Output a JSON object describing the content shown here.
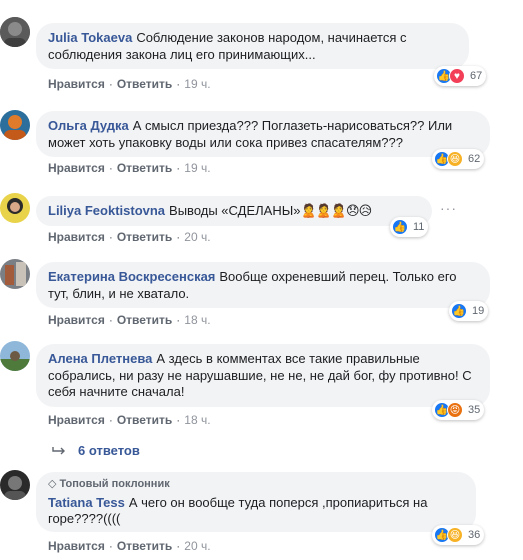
{
  "actions": {
    "like": "Нравится",
    "reply": "Ответить",
    "sep": "·"
  },
  "comments": [
    {
      "author": "Julia Tokaeva",
      "text": "Соблюдение законов народом, начинается с соблюдения закона лиц его принимающих...",
      "time": "19 ч.",
      "reactions": [
        "like",
        "love"
      ],
      "count": "67"
    },
    {
      "author": "Ольга Дудка",
      "text": "А смысл приезда??? Поглазеть-нарисоваться?? Или может хоть упаковку воды или сока привез спасателям???",
      "time": "19 ч.",
      "reactions": [
        "like",
        "haha"
      ],
      "count": "62"
    },
    {
      "author": "Liliya Feoktistovna",
      "text": "Выводы «СДЕЛАНЫ»",
      "emojis": "🙎🙎🙎😞😥",
      "time": "20 ч.",
      "reactions": [
        "like"
      ],
      "count": "11",
      "more": "···"
    },
    {
      "author": "Екатерина Воскресенская",
      "text": "Вообще охреневший перец. Только его тут, блин, и не хватало.",
      "time": "18 ч.",
      "reactions": [
        "like"
      ],
      "count": "19"
    },
    {
      "author": "Алена Плетнева",
      "text": "А здесь в комментах все такие правильные собрались, ни разу не нарушавшие, не не, не дай бог, фу противно! С себя начните сначала!",
      "time": "18 ч.",
      "reactions": [
        "like",
        "angry"
      ],
      "count": "35"
    },
    {
      "badge": "Топовый поклонник",
      "author": "Tatiana Tess",
      "text": "А чего он вообще туда поперся ,пропиариться на горе????((((",
      "time": "20 ч.",
      "reactions": [
        "like",
        "haha"
      ],
      "count": "36"
    }
  ],
  "replies": {
    "label": "6 ответов"
  },
  "colors": {
    "link": "#385898",
    "bubble": "#f2f3f5",
    "like": "#1877f2"
  }
}
